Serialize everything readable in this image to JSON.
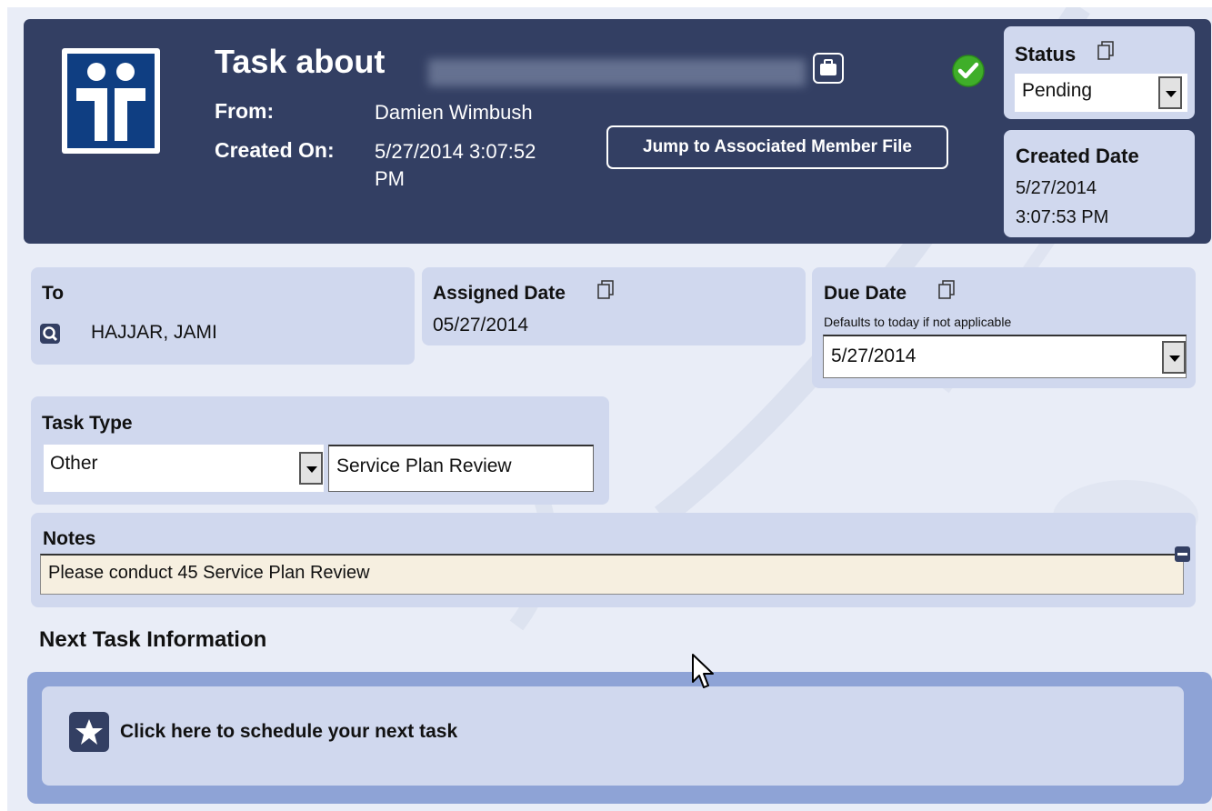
{
  "header": {
    "title": "Task about",
    "from_label": "From:",
    "from_value": "Damien Wimbush",
    "created_on_label": "Created On:",
    "created_on_value_line1": "5/27/2014 3:07:52",
    "created_on_value_line2": "PM",
    "jump_button": "Jump to Associated Member File",
    "status_icon": "check-circle-icon",
    "colors": {
      "header_bg": "#333f63",
      "card_bg": "#d0d8ee",
      "accent_check": "#3fae29"
    }
  },
  "status": {
    "label": "Status",
    "selected": "Pending"
  },
  "created_date": {
    "label": "Created Date",
    "value_line1": "5/27/2014",
    "value_line2": "3:07:53 PM"
  },
  "to": {
    "label": "To",
    "value": "HAJJAR, JAMI"
  },
  "assigned_date": {
    "label": "Assigned Date",
    "value": "05/27/2014"
  },
  "due_date": {
    "label": "Due Date",
    "hint": "Defaults to today if not applicable",
    "selected": "5/27/2014"
  },
  "task_type": {
    "label": "Task Type",
    "selected": "Other",
    "detail": "Service Plan Review"
  },
  "notes": {
    "label": "Notes",
    "value": "Please conduct 45 Service Plan Review"
  },
  "next_task": {
    "heading": "Next Task Information",
    "schedule_text": "Click here to schedule your next task"
  }
}
